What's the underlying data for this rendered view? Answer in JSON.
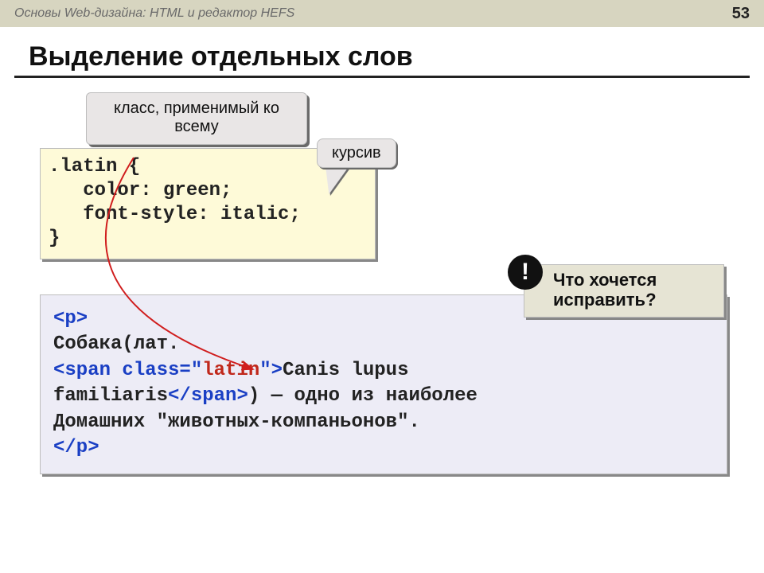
{
  "topbar": {
    "title": "Основы Web-дизайна: HTML и редактор HEFS",
    "pagenum": "53"
  },
  "heading": "Выделение отдельных слов",
  "callouts": {
    "class_all": "класс, применимый ко всему",
    "italic": "курсив"
  },
  "cssbox": {
    "l1": ".latin {",
    "l2": "   color: green;",
    "l3": "   font-style: italic;",
    "l4": "}"
  },
  "htmlbox": {
    "p_open": "<p>",
    "line1": "Собака(лат.",
    "span_open_a": "<span class=\"",
    "span_class": "latin",
    "span_open_b": "\">",
    "text_mid1": "Canis lupus",
    "text_mid2": "familiaris",
    "span_close": "</span>",
    "tail": ") — одно из наиболее",
    "line4": "Домашних \"животных-компаньонов\".",
    "p_close": "</p>"
  },
  "question": {
    "bang": "!",
    "text": "Что хочется исправить?"
  }
}
